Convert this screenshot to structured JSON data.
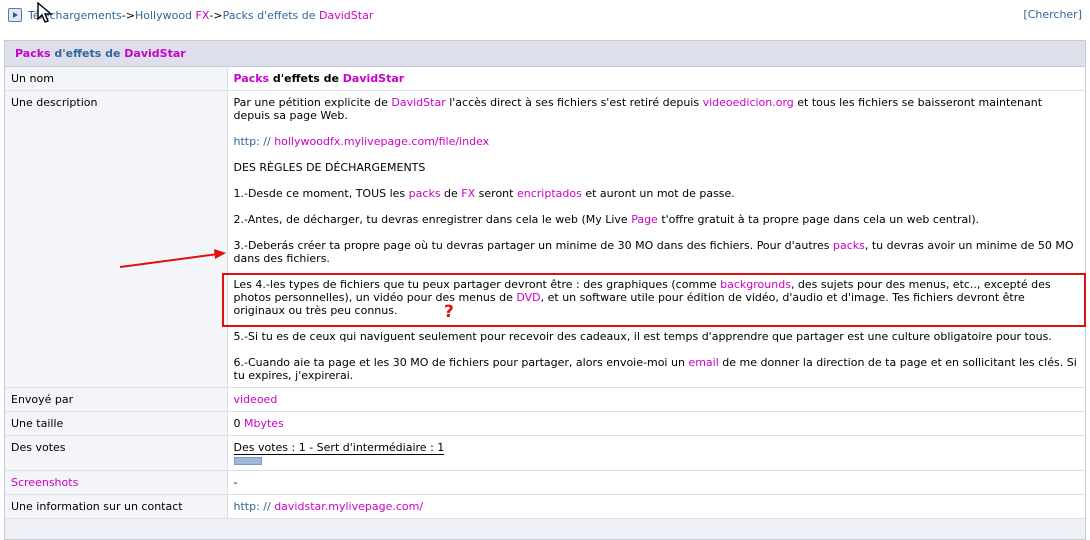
{
  "breadcrumb": {
    "item1": "Téléchargements",
    "sep1": "-> ",
    "item2_a": "Hollywood ",
    "item2_b": "FX",
    "sep2": "-> ",
    "item3_a": "Packs d'effets de ",
    "item3_b": "DavidStar"
  },
  "search_label": "[Chercher]",
  "panel_title_a": "Packs",
  "panel_title_b": " d'effets de ",
  "panel_title_c": "DavidStar",
  "rows": {
    "name": {
      "label": "Un nom",
      "v1": "Packs",
      "v2": " d'effets de ",
      "v3": "DavidStar"
    },
    "description": {
      "label": "Une description",
      "p1_a": "Par une pétition explicite de ",
      "p1_b": "DavidStar",
      "p1_c": " l'accès direct à ses fichiers s'est retiré depuis ",
      "p1_d": "videoedicion.org",
      "p1_e": " et tous les fichiers se baisseront maintenant depuis sa page Web.",
      "p2_a": "http: // ",
      "p2_b": "hollywoodfx.mylivepage.com/file/index",
      "p3": "DES RÈGLES DE DÉCHARGEMENTS",
      "p4_a": "1.-Desde ce moment, TOUS les ",
      "p4_b": "packs",
      "p4_c": " de ",
      "p4_d": "FX",
      "p4_e": " seront ",
      "p4_f": "encriptados",
      "p4_g": " et auront un mot de passe.",
      "p5_a": "2.-Antes, de décharger, tu devras enregistrer dans cela le web (My Live ",
      "p5_b": "Page",
      "p5_c": " t'offre gratuit à ta propre page dans cela un web central).",
      "p6_a": "3.-Deberás créer ta propre page où tu devras partager un minime de 30 MO dans des fichiers. Pour d'autres ",
      "p6_b": "packs",
      "p6_c": ", tu devras avoir un minime de 50 MO dans des fichiers.",
      "p7_a": "Les 4.-les types de fichiers que tu peux partager devront être : des graphiques (comme ",
      "p7_b": "backgrounds",
      "p7_c": ", des sujets pour des menus, etc.., excepté des photos personnelles), un vidéo pour des menus de ",
      "p7_d": "DVD",
      "p7_e": ", et un software utile pour édition de vidéo, d'audio et d'image. Tes fichiers devront être originaux ou très peu connus.",
      "p8": "5.-Si tu es de ceux qui naviguent seulement pour recevoir des cadeaux, il est temps d'apprendre que partager est une culture obligatoire pour tous.",
      "p9_a": "6.-Cuando aie ta page et les 30 MO de fichiers pour partager, alors envoie-moi un ",
      "p9_b": "email",
      "p9_c": " de me donner la direction de ta page et en sollicitant les clés. Si tu expires, j'expirerai."
    },
    "sent_by": {
      "label": "Envoyé par",
      "value": "videoed"
    },
    "size": {
      "label": "Une taille",
      "v1": "0 ",
      "v2": "Mbytes"
    },
    "votes": {
      "label": "Des votes",
      "value": "Des votes : 1 - Sert d'intermédiaire : 1",
      "rating_fraction": 0.2
    },
    "screenshots": {
      "label": "Screenshots",
      "value": "-"
    },
    "contact": {
      "label": "Une information sur un contact",
      "v1": "http: // ",
      "v2": "davidstar.mylivepage.com/"
    }
  },
  "annotation": {
    "mark": "?",
    "color": "#e01010"
  },
  "colors": {
    "link": "#336699",
    "highlight": "#cc00cc",
    "annotation": "#e01010"
  }
}
